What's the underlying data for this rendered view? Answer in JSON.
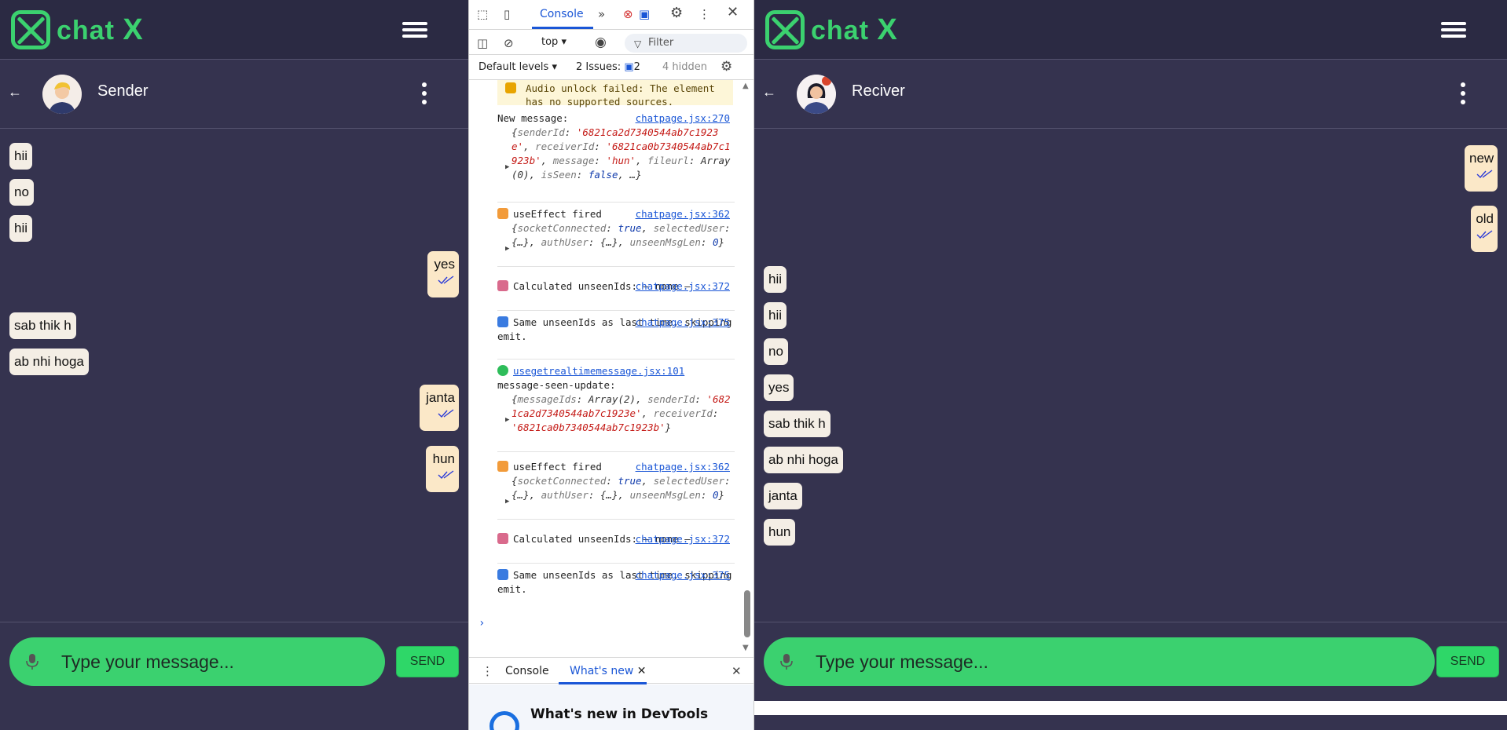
{
  "app": {
    "logo_text": "chat",
    "logo_x": "X",
    "colors": {
      "brand": "#3bd16f",
      "bg": "#35334f",
      "topbar": "#2b2a43",
      "received_bubble": "#f4eee5",
      "sent_bubble": "#fbe8c8",
      "tick": "#2a3ad8"
    }
  },
  "left_chat": {
    "contact_name": "Sender",
    "messages": [
      {
        "text": "hii",
        "side": "received"
      },
      {
        "text": "no",
        "side": "received"
      },
      {
        "text": "hii",
        "side": "received"
      },
      {
        "text": "yes",
        "side": "sent",
        "seen": true
      },
      {
        "text": "sab thik h",
        "side": "received"
      },
      {
        "text": "ab nhi hoga",
        "side": "received"
      },
      {
        "text": "janta",
        "side": "sent",
        "seen": true
      },
      {
        "text": "hun",
        "side": "sent",
        "seen": true
      }
    ],
    "input_placeholder": "Type your message...",
    "send_label": "SEND"
  },
  "right_chat": {
    "contact_name": "Reciver",
    "messages": [
      {
        "text": "new",
        "side": "sent",
        "seen": true
      },
      {
        "text": "old",
        "side": "sent",
        "seen": true
      },
      {
        "text": "hii",
        "side": "received"
      },
      {
        "text": "hii",
        "side": "received"
      },
      {
        "text": "no",
        "side": "received"
      },
      {
        "text": "yes",
        "side": "received"
      },
      {
        "text": "sab thik h",
        "side": "received"
      },
      {
        "text": "ab nhi hoga",
        "side": "received"
      },
      {
        "text": "janta",
        "side": "received"
      },
      {
        "text": "hun",
        "side": "received"
      }
    ],
    "input_placeholder": "Type your message...",
    "send_label": "SEND"
  },
  "devtools": {
    "tab_console": "Console",
    "context": "top",
    "filter_placeholder": "Filter",
    "levels": "Default levels",
    "issues_label": "2 Issues:",
    "issues_count": "2",
    "hidden": "4 hidden",
    "warning": "Audio unlock failed: The element has no supported sources.",
    "entries": [
      {
        "label": "New message:",
        "source": "chatpage.jsx:270"
      },
      {
        "label": "useEffect fired",
        "source": "chatpage.jsx:362"
      },
      {
        "label": "Calculated unseenIds: — none —",
        "source": "chatpage.jsx:372"
      },
      {
        "label": "Same unseenIds as last time, skipping emit.",
        "source": "chatpage.jsx:375"
      },
      {
        "label": "message-seen-update:",
        "source": "usegetrealtimemessage.jsx:101"
      },
      {
        "label": "useEffect fired",
        "source": "chatpage.jsx:362"
      },
      {
        "label": "Calculated unseenIds: — none —",
        "source": "chatpage.jsx:372"
      },
      {
        "label": "Same unseenIds as last time, skipping emit.",
        "source": "chatpage.jsx:375"
      }
    ],
    "obj1": {
      "senderId": "'6821ca2d7340544ab7c1923e'",
      "receiverId": "'6821ca0b7340544ab7c1923b'",
      "message": "'hun'",
      "fileurl": "Array(0)",
      "isSeen": "false"
    },
    "obj_effect": {
      "socketConnected": "true",
      "selectedUser": "{…}",
      "authUser": "{…}",
      "unseenMsgLen": "0"
    },
    "obj_seen": {
      "messageIds": "Array(2)",
      "senderId": "'6821ca2d7340544ab7c1923e'",
      "receiverId": "'6821ca0b7340544ab7c1923b'"
    },
    "drawer_tab_console": "Console",
    "drawer_tab_whatsnew": "What's new",
    "whatsnew_title": "What's new in DevTools"
  }
}
